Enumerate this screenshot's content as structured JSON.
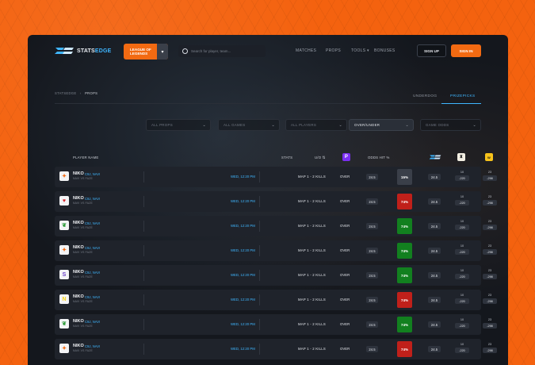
{
  "brand": {
    "logo_left": "STATS",
    "logo_right": "EDGE",
    "accent": "#f26a12",
    "blue": "#3fb6ff"
  },
  "game_select": {
    "label": "LEAGUE OF LEGENDS"
  },
  "search": {
    "placeholder": "Search for player, team..."
  },
  "nav": [
    "MATCHES",
    "PROPS",
    "TOOLS",
    "BONUSES"
  ],
  "auth": {
    "signup": "SIGN UP",
    "signin": "SIGN IN"
  },
  "breadcrumb": {
    "root": "STATSEDGE",
    "sep": "›",
    "current": "PROPS"
  },
  "tabs": [
    {
      "label": "UNDERDOG",
      "active": false
    },
    {
      "label": "PRIZEPICKS",
      "active": true
    }
  ],
  "filters": [
    {
      "label": "ALL PROPS",
      "selected": false
    },
    {
      "label": "ALL GAMES",
      "selected": false
    },
    {
      "label": "ALL PLAYERS",
      "selected": false
    },
    {
      "label": "OVER/UNDER",
      "selected": true
    },
    {
      "label": "GAME ODDS",
      "selected": false
    }
  ],
  "table": {
    "headers": {
      "player": "PLAYER NAME",
      "stats": "STATS",
      "ou": "U/O ⇅",
      "odds_hit": "ODDS HIT %"
    },
    "rows": [
      {
        "name": "NIKO",
        "team": "C9J, NAVI",
        "match": "NAVI VS FAZE",
        "date": "WED, 12:20 PM",
        "stat": "MAP 1 - 2 KILLS",
        "ou": "OVER",
        "line": "24.5",
        "hit": "15%",
        "hit_color": "#3a3f49",
        "line2": "24.5",
        "o1_top": "10",
        "o1": "-220",
        "o2_top": "23",
        "o2": "-298",
        "logo": "fnatic",
        "logo_color": "#f26a12"
      },
      {
        "name": "NIKO",
        "team": "C9J, NAVI",
        "match": "NAVI VS FAZE",
        "date": "WED, 12:20 PM",
        "stat": "MAP 1 - 2 KILLS",
        "ou": "OVER",
        "line": "24.5",
        "hit": "74%",
        "hit_color": "#c0201a",
        "line2": "24.5",
        "o1_top": "10",
        "o1": "-220",
        "o2_top": "23",
        "o2": "-298",
        "logo": "vitality",
        "logo_color": "#d6232a"
      },
      {
        "name": "NIKO",
        "team": "C9J, NAVI",
        "match": "NAVI VS FAZE",
        "date": "WED, 12:20 PM",
        "stat": "MAP 1 - 2 KILLS",
        "ou": "OVER",
        "line": "24.5",
        "hit": "74%",
        "hit_color": "#12801f",
        "line2": "24.5",
        "o1_top": "10",
        "o1": "-220",
        "o2_top": "23",
        "o2": "-298",
        "logo": "leaf",
        "logo_color": "#2e9b3a"
      },
      {
        "name": "NIKO",
        "team": "C9J, NAVI",
        "match": "NAVI VS FAZE",
        "date": "WED, 12:20 PM",
        "stat": "MAP 1 - 2 KILLS",
        "ou": "OVER",
        "line": "24.5",
        "hit": "74%",
        "hit_color": "#12801f",
        "line2": "24.5",
        "o1_top": "10",
        "o1": "-220",
        "o2_top": "23",
        "o2": "-298",
        "logo": "fnatic",
        "logo_color": "#f26a12"
      },
      {
        "name": "NIKO",
        "team": "C9J, NAVI",
        "match": "NAVI VS FAZE",
        "date": "WED, 12:20 PM",
        "stat": "MAP 1 - 2 KILLS",
        "ou": "OVER",
        "line": "24.5",
        "hit": "74%",
        "hit_color": "#12801f",
        "line2": "24.5",
        "o1_top": "10",
        "o1": "-220",
        "o2_top": "23",
        "o2": "-298",
        "logo": "sk",
        "logo_color": "#6b3fc8"
      },
      {
        "name": "NIKO",
        "team": "C9J, NAVI",
        "match": "NAVI VS FAZE",
        "date": "WED, 12:20 PM",
        "stat": "MAP 1 - 2 KILLS",
        "ou": "OVER",
        "line": "24.5",
        "hit": "74%",
        "hit_color": "#c0201a",
        "line2": "24.5",
        "o1_top": "10",
        "o1": "-220",
        "o2_top": "23",
        "o2": "-298",
        "logo": "navi",
        "logo_color": "#f7d417"
      },
      {
        "name": "NIKO",
        "team": "C9J, NAVI",
        "match": "NAVI VS FAZE",
        "date": "WED, 12:20 PM",
        "stat": "MAP 1 - 2 KILLS",
        "ou": "OVER",
        "line": "24.5",
        "hit": "74%",
        "hit_color": "#12801f",
        "line2": "24.5",
        "o1_top": "10",
        "o1": "-220",
        "o2_top": "23",
        "o2": "-298",
        "logo": "leaf",
        "logo_color": "#2e9b3a"
      },
      {
        "name": "NIKO",
        "team": "C9J, NAVI",
        "match": "NAVI VS FAZE",
        "date": "WED, 12:20 PM",
        "stat": "MAP 1 - 2 KILLS",
        "ou": "OVER",
        "line": "24.5",
        "hit": "74%",
        "hit_color": "#c0201a",
        "line2": "24.5",
        "o1_top": "10",
        "o1": "-220",
        "o2_top": "23",
        "o2": "-298",
        "logo": "fnatic",
        "logo_color": "#f26a12"
      }
    ]
  }
}
